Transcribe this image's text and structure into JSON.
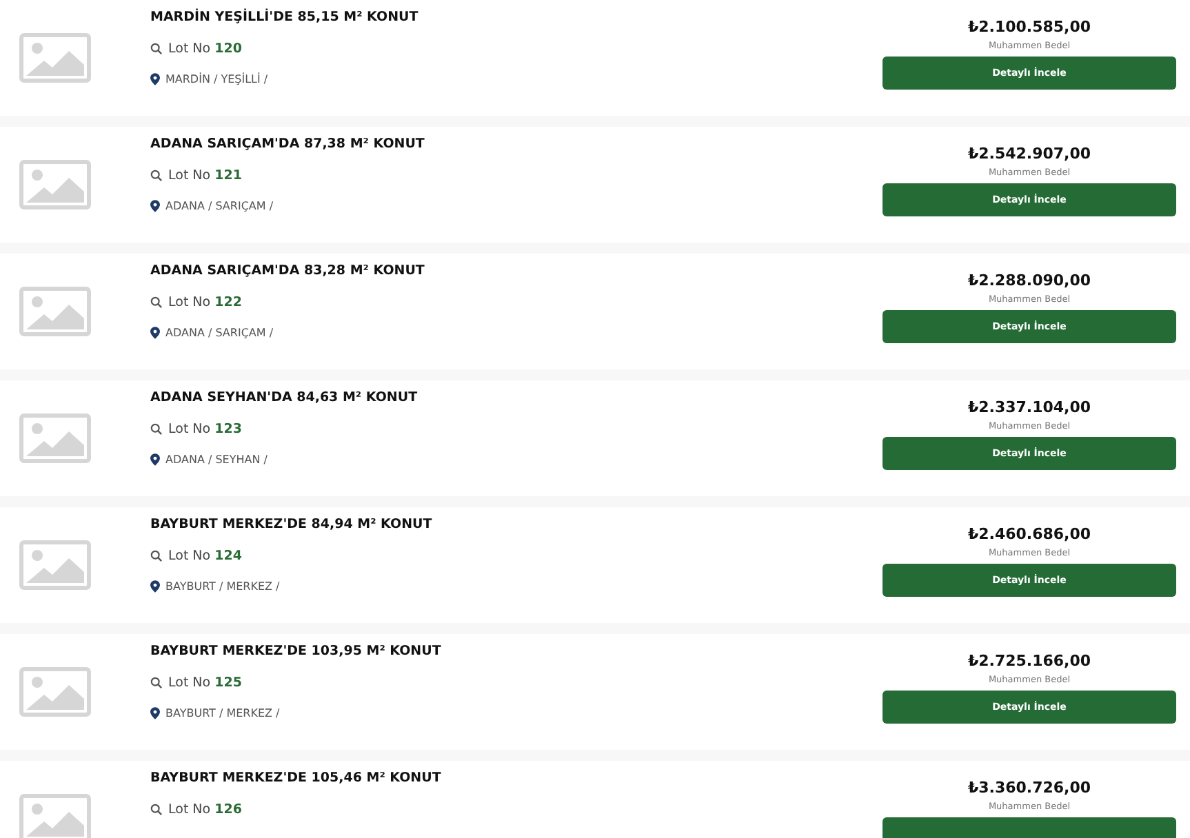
{
  "listings": [
    {
      "title": "MARDİN YEŞİLLİ'DE 85,15 M² KONUT",
      "lot_label": "Lot No",
      "lot_number": "120",
      "location": "MARDİN / YEŞİLLİ /",
      "price": "₺2.100.585,00",
      "price_caption": "Muhammen Bedel",
      "button": "Detaylı İncele"
    },
    {
      "title": "ADANA SARIÇAM'DA 87,38 M² KONUT",
      "lot_label": "Lot No",
      "lot_number": "121",
      "location": "ADANA / SARIÇAM /",
      "price": "₺2.542.907,00",
      "price_caption": "Muhammen Bedel",
      "button": "Detaylı İncele"
    },
    {
      "title": "ADANA SARIÇAM'DA 83,28 M² KONUT",
      "lot_label": "Lot No",
      "lot_number": "122",
      "location": "ADANA / SARIÇAM /",
      "price": "₺2.288.090,00",
      "price_caption": "Muhammen Bedel",
      "button": "Detaylı İncele"
    },
    {
      "title": "ADANA SEYHAN'DA 84,63 M² KONUT",
      "lot_label": "Lot No",
      "lot_number": "123",
      "location": "ADANA / SEYHAN /",
      "price": "₺2.337.104,00",
      "price_caption": "Muhammen Bedel",
      "button": "Detaylı İncele"
    },
    {
      "title": "BAYBURT MERKEZ'DE 84,94 M² KONUT",
      "lot_label": "Lot No",
      "lot_number": "124",
      "location": "BAYBURT / MERKEZ /",
      "price": "₺2.460.686,00",
      "price_caption": "Muhammen Bedel",
      "button": "Detaylı İncele"
    },
    {
      "title": "BAYBURT MERKEZ'DE 103,95 M² KONUT",
      "lot_label": "Lot No",
      "lot_number": "125",
      "location": "BAYBURT / MERKEZ /",
      "price": "₺2.725.166,00",
      "price_caption": "Muhammen Bedel",
      "button": "Detaylı İncele"
    },
    {
      "title": "BAYBURT MERKEZ'DE 105,46 M² KONUT",
      "lot_label": "Lot No",
      "lot_number": "126",
      "price": "₺3.360.726,00",
      "price_caption": "Muhammen Bedel"
    }
  ]
}
